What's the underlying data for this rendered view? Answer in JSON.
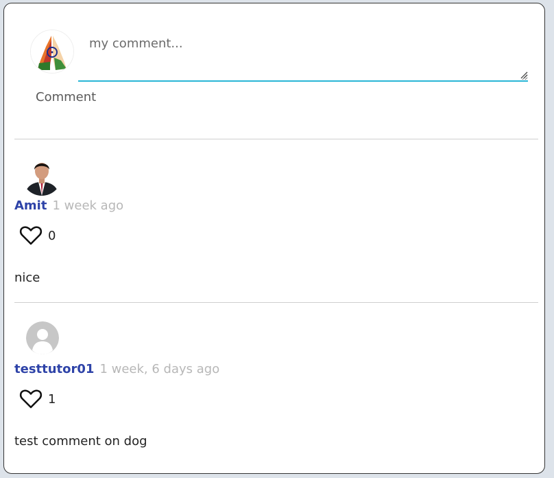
{
  "composer": {
    "placeholder": "my comment...",
    "submit_label": "Comment"
  },
  "comments": [
    {
      "author": "Amit",
      "time": "1 week ago",
      "likes": "0",
      "text": "nice"
    },
    {
      "author": "testtutor01",
      "time": "1 week, 6 days ago",
      "likes": "1",
      "text": "test comment on dog"
    }
  ],
  "colors": {
    "accent": "#29b6d6",
    "author": "#2e43a8",
    "muted": "#b7b7b7"
  }
}
